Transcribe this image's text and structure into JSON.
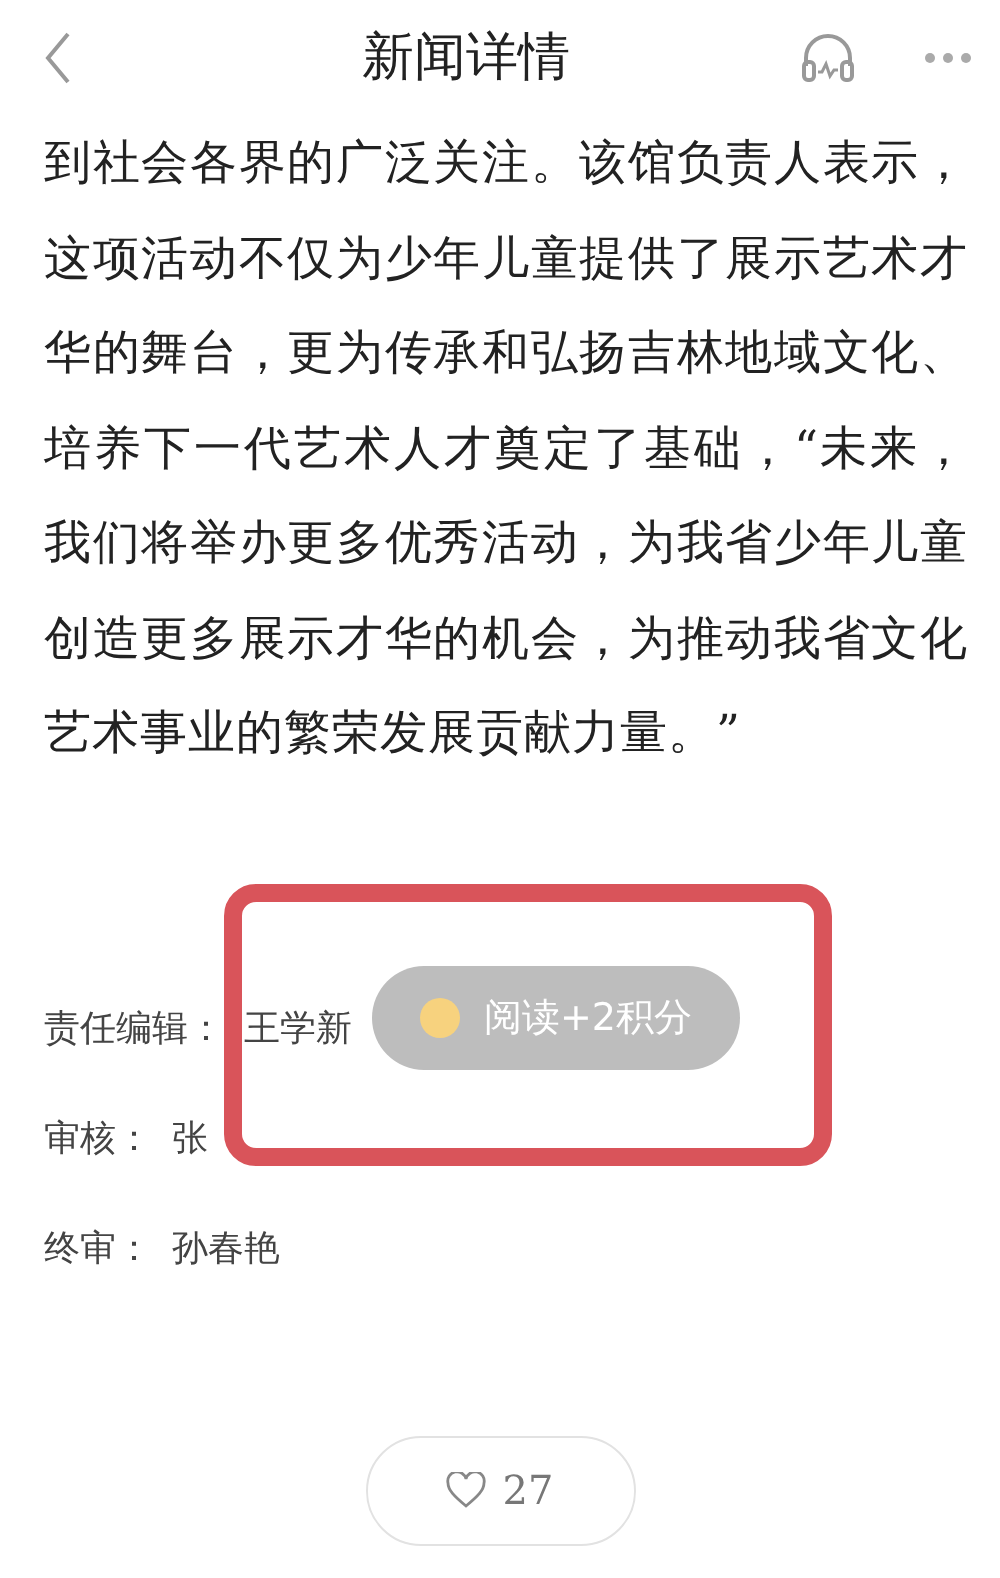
{
  "header": {
    "title": "新闻详情"
  },
  "article": {
    "text": "到社会各界的广泛关注。该馆负责人表示，这项活动不仅为少年儿童提供了展示艺术才华的舞台，更为传承和弘扬吉林地域文化、培养下一代艺术人才奠定了基础，“未来，我们将举办更多优秀活动，为我省少年儿童创造更多展示才华的机会，为推动我省文化艺术事业的繁荣发展贡献力量。”"
  },
  "credits": [
    {
      "label": "责任编辑：",
      "name": "王学新"
    },
    {
      "label": "审核：",
      "name": "张"
    },
    {
      "label": "终审：",
      "name": "孙春艳"
    }
  ],
  "toast": {
    "text": "阅读+2积分"
  },
  "like": {
    "count": "27"
  }
}
